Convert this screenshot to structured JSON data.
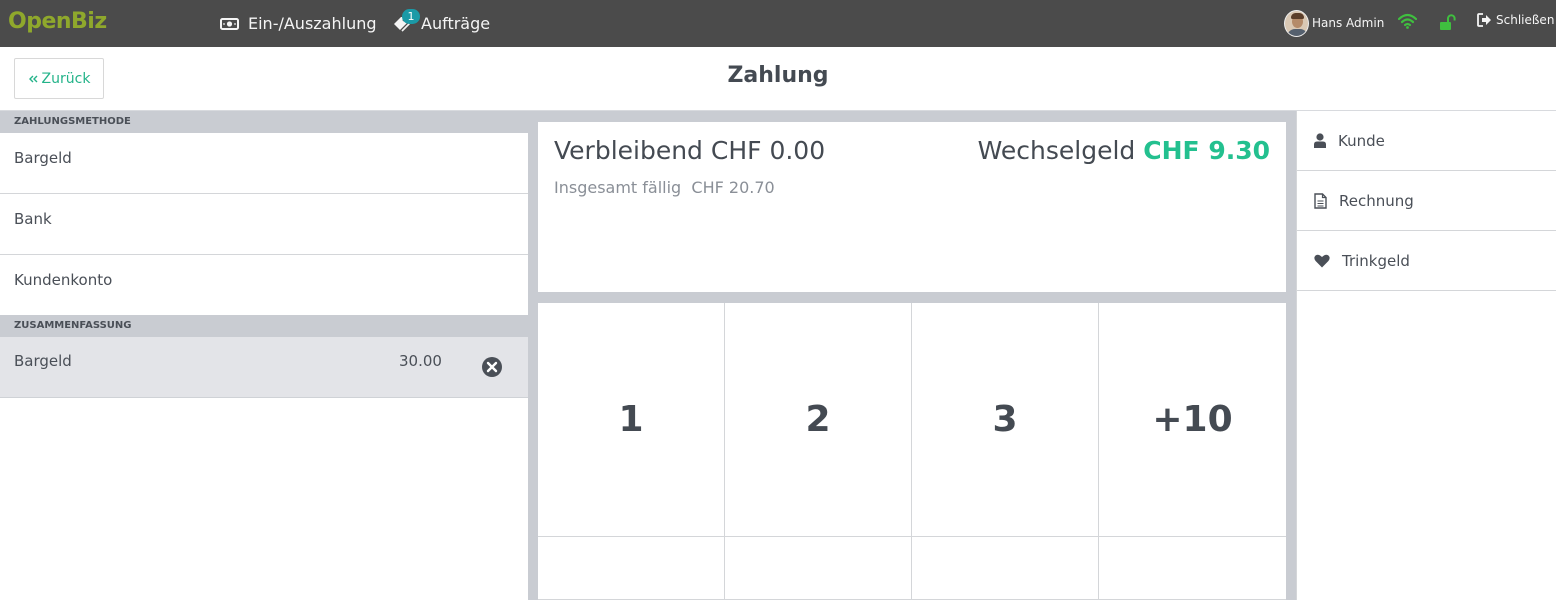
{
  "app": {
    "logo": "OpenBiz",
    "nav": {
      "cash_label": "Ein-/Auszahlung",
      "orders_label": "Aufträge",
      "orders_badge": "1"
    },
    "user_name": "Hans Admin",
    "close_label": "Schließen",
    "colors": {
      "topbar": "#4b4b4b",
      "logo": "#8fa82c",
      "accent": "#23b389",
      "badge": "#1b9aa7",
      "status_green": "#3fbf3f"
    },
    "icons": {
      "cash": "money-bill-icon",
      "orders": "tags-icon",
      "wifi": "wifi-icon",
      "lock": "unlock-icon",
      "close": "sign-out-icon"
    }
  },
  "header": {
    "back_label": "Zurück",
    "title": "Zahlung"
  },
  "payment_methods": {
    "heading": "ZAHLUNGSMETHODE",
    "items": [
      "Bargeld",
      "Bank",
      "Kundenkonto"
    ]
  },
  "summary": {
    "heading": "ZUSAMMENFASSUNG",
    "rows": [
      {
        "method": "Bargeld",
        "amount": "30.00"
      }
    ]
  },
  "status": {
    "remaining": "Verbleibend CHF 0.00",
    "total_due_label": "Insgesamt fällig",
    "total_due_amount": "CHF 20.70",
    "change_label": "Wechselgeld",
    "change_amount": "CHF 9.30"
  },
  "keypad": {
    "keys": [
      "1",
      "2",
      "3",
      "+10",
      "",
      "",
      "",
      ""
    ]
  },
  "actions": {
    "customer": "Kunde",
    "invoice": "Rechnung",
    "tip": "Trinkgeld"
  }
}
